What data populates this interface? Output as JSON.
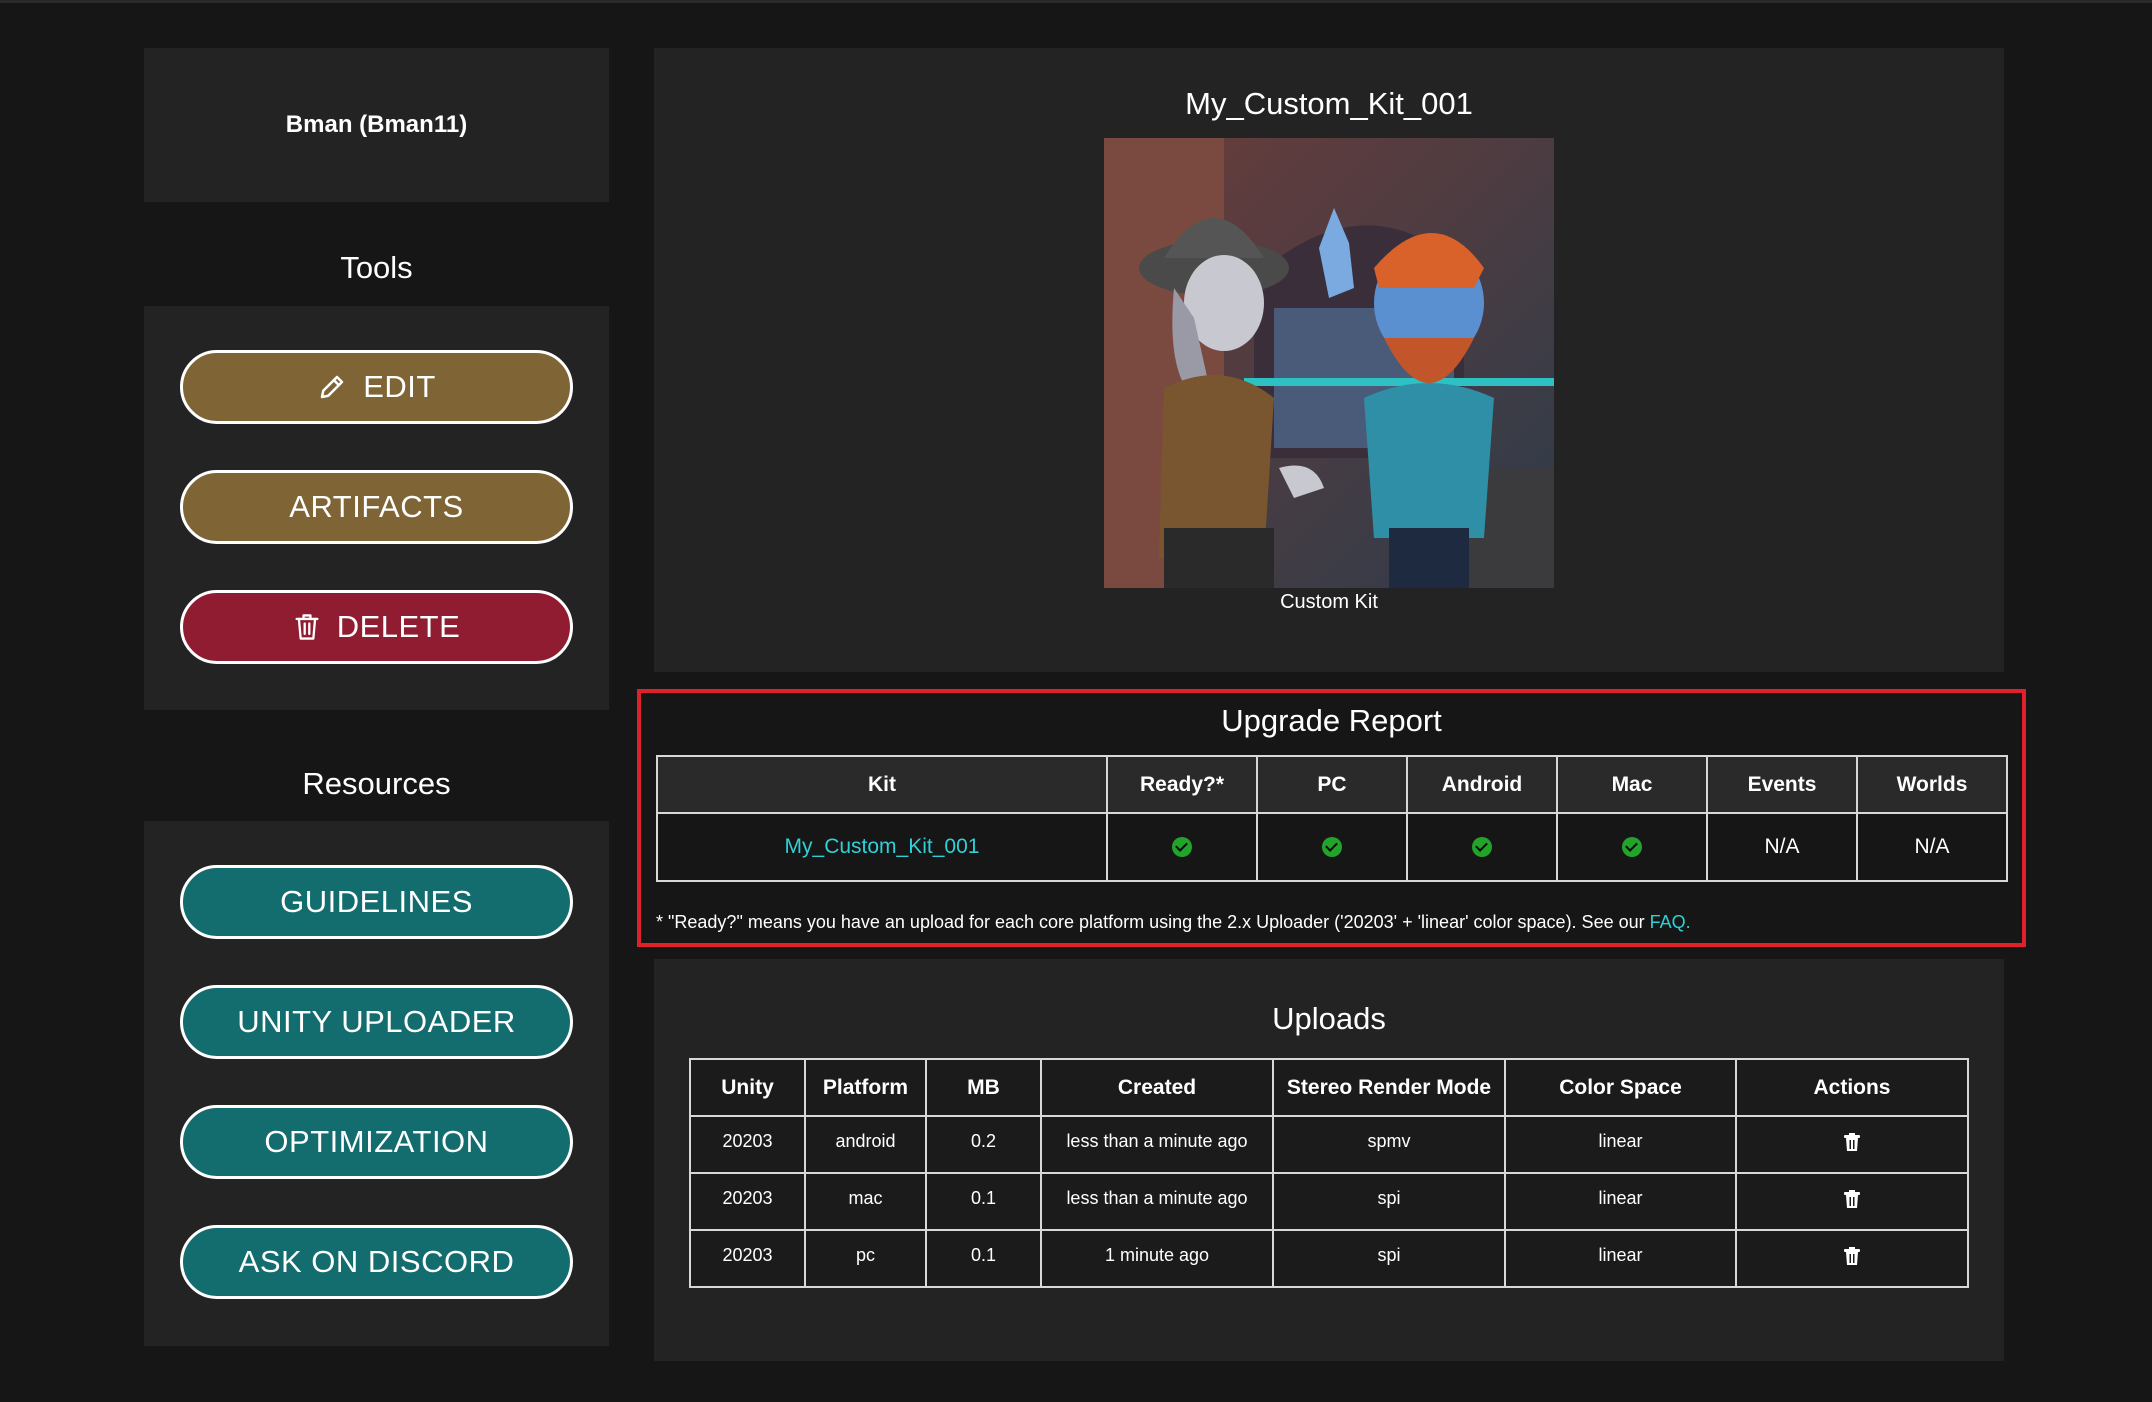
{
  "user": {
    "display_name": "Bman (Bman11)"
  },
  "tools": {
    "heading": "Tools",
    "edit_label": "EDIT",
    "artifacts_label": "ARTIFACTS",
    "delete_label": "DELETE"
  },
  "resources": {
    "heading": "Resources",
    "guidelines_label": "GUIDELINES",
    "unity_uploader_label": "UNITY UPLOADER",
    "optimization_label": "OPTIMIZATION",
    "discord_label": "ASK ON DISCORD"
  },
  "kit": {
    "title": "My_Custom_Kit_001",
    "caption": "Custom Kit"
  },
  "upgrade_report": {
    "title": "Upgrade Report",
    "columns": [
      "Kit",
      "Ready?*",
      "PC",
      "Android",
      "Mac",
      "Events",
      "Worlds"
    ],
    "row": {
      "kit": "My_Custom_Kit_001",
      "ready": "check",
      "pc": "check",
      "android": "check",
      "mac": "check",
      "events": "N/A",
      "worlds": "N/A"
    },
    "note": "* \"Ready?\" means you have an upload for each core platform using the 2.x Uploader ('20203' + 'linear' color space). See our ",
    "note_link": "FAQ."
  },
  "uploads": {
    "title": "Uploads",
    "columns": [
      "Unity",
      "Platform",
      "MB",
      "Created",
      "Stereo Render Mode",
      "Color Space",
      "Actions"
    ],
    "rows": [
      {
        "unity": "20203",
        "platform": "android",
        "mb": "0.2",
        "created": "less than a minute ago",
        "stereo": "spmv",
        "color_space": "linear",
        "action": "trash-icon"
      },
      {
        "unity": "20203",
        "platform": "mac",
        "mb": "0.1",
        "created": "less than a minute ago",
        "stereo": "spi",
        "color_space": "linear",
        "action": "trash-icon"
      },
      {
        "unity": "20203",
        "platform": "pc",
        "mb": "0.1",
        "created": "1 minute ago",
        "stereo": "spi",
        "color_space": "linear",
        "action": "trash-icon"
      }
    ]
  },
  "colors": {
    "brown_button": "#7f6535",
    "red_button": "#8f1c30",
    "teal_button": "#136c6e",
    "link": "#2fd0d6",
    "highlight_border": "#e0202a",
    "check": "#22a32a"
  }
}
